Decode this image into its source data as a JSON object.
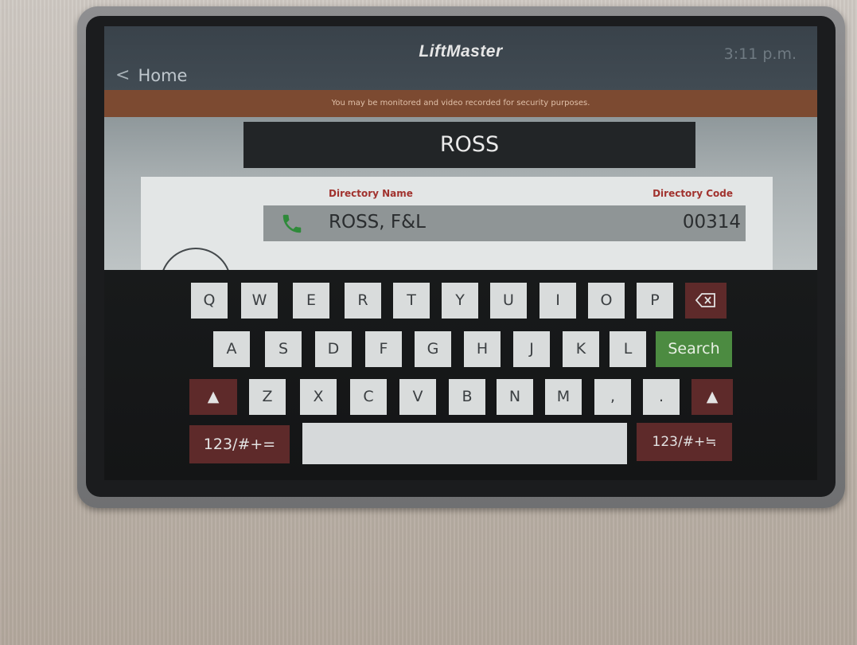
{
  "header": {
    "brand": "LiftMaster",
    "time": "3:11 p.m.",
    "back_label": "Home"
  },
  "notice": "You may be monitored and video recorded for security purposes.",
  "search": {
    "query": "ROSS"
  },
  "directory": {
    "name_header": "Directory Name",
    "code_header": "Directory Code",
    "entries": [
      {
        "name": "ROSS, F&L",
        "code": "00314"
      }
    ]
  },
  "keyboard": {
    "row1": [
      "Q",
      "W",
      "E",
      "R",
      "T",
      "Y",
      "U",
      "I",
      "O",
      "P"
    ],
    "row2": [
      "A",
      "S",
      "D",
      "F",
      "G",
      "H",
      "J",
      "K",
      "L"
    ],
    "row3": [
      "Z",
      "X",
      "C",
      "V",
      "B",
      "N",
      "M",
      ",",
      "."
    ],
    "search_label": "Search",
    "symbols_left": "123/#+=",
    "symbols_right": "123/#+≒"
  },
  "colors": {
    "accent_green": "#4c8b41",
    "key_dark": "#5e2a2a",
    "notice_bar": "#7c4a31",
    "header_red": "#a1322e"
  }
}
